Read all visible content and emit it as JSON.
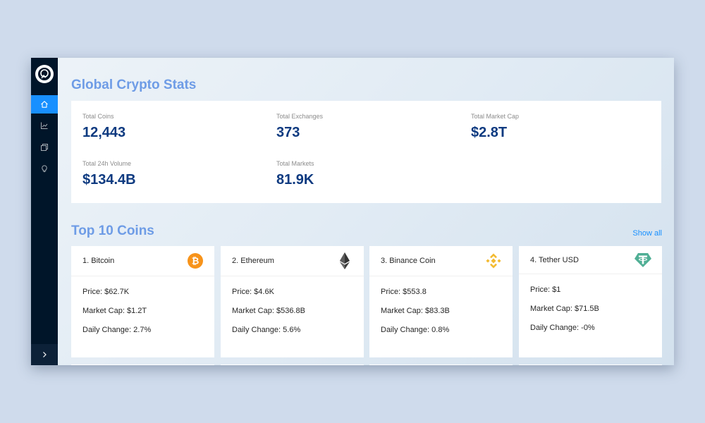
{
  "sidebar": {
    "items": [
      {
        "icon": "home-icon"
      },
      {
        "icon": "chart-icon"
      },
      {
        "icon": "cards-icon"
      },
      {
        "icon": "bulb-icon"
      }
    ],
    "collapse_icon": "chevron-right-icon"
  },
  "stats": {
    "title": "Global Crypto Stats",
    "items": [
      {
        "label": "Total Coins",
        "value": "12,443"
      },
      {
        "label": "Total Exchanges",
        "value": "373"
      },
      {
        "label": "Total Market Cap",
        "value": "$2.8T"
      },
      {
        "label": "Total 24h Volume",
        "value": "$134.4B"
      },
      {
        "label": "Total Markets",
        "value": "81.9K"
      }
    ]
  },
  "top": {
    "title": "Top 10 Coins",
    "show_all": "Show all",
    "coins": [
      {
        "name": "1. Bitcoin",
        "price": "Price: $62.7K",
        "market_cap": "Market Cap: $1.2T",
        "change": "Daily Change: 2.7%",
        "icon": "bitcoin-icon",
        "color": "#f7931a"
      },
      {
        "name": "2. Ethereum",
        "price": "Price: $4.6K",
        "market_cap": "Market Cap: $536.8B",
        "change": "Daily Change: 5.6%",
        "icon": "ethereum-icon",
        "color": "#343434"
      },
      {
        "name": "3. Binance Coin",
        "price": "Price: $553.8",
        "market_cap": "Market Cap: $83.3B",
        "change": "Daily Change: 0.8%",
        "icon": "binance-icon",
        "color": "#f3ba2f"
      },
      {
        "name": "4. Tether USD",
        "price": "Price: $1",
        "market_cap": "Market Cap: $71.5B",
        "change": "Daily Change: -0%",
        "icon": "tether-icon",
        "color": "#50af95"
      }
    ]
  }
}
